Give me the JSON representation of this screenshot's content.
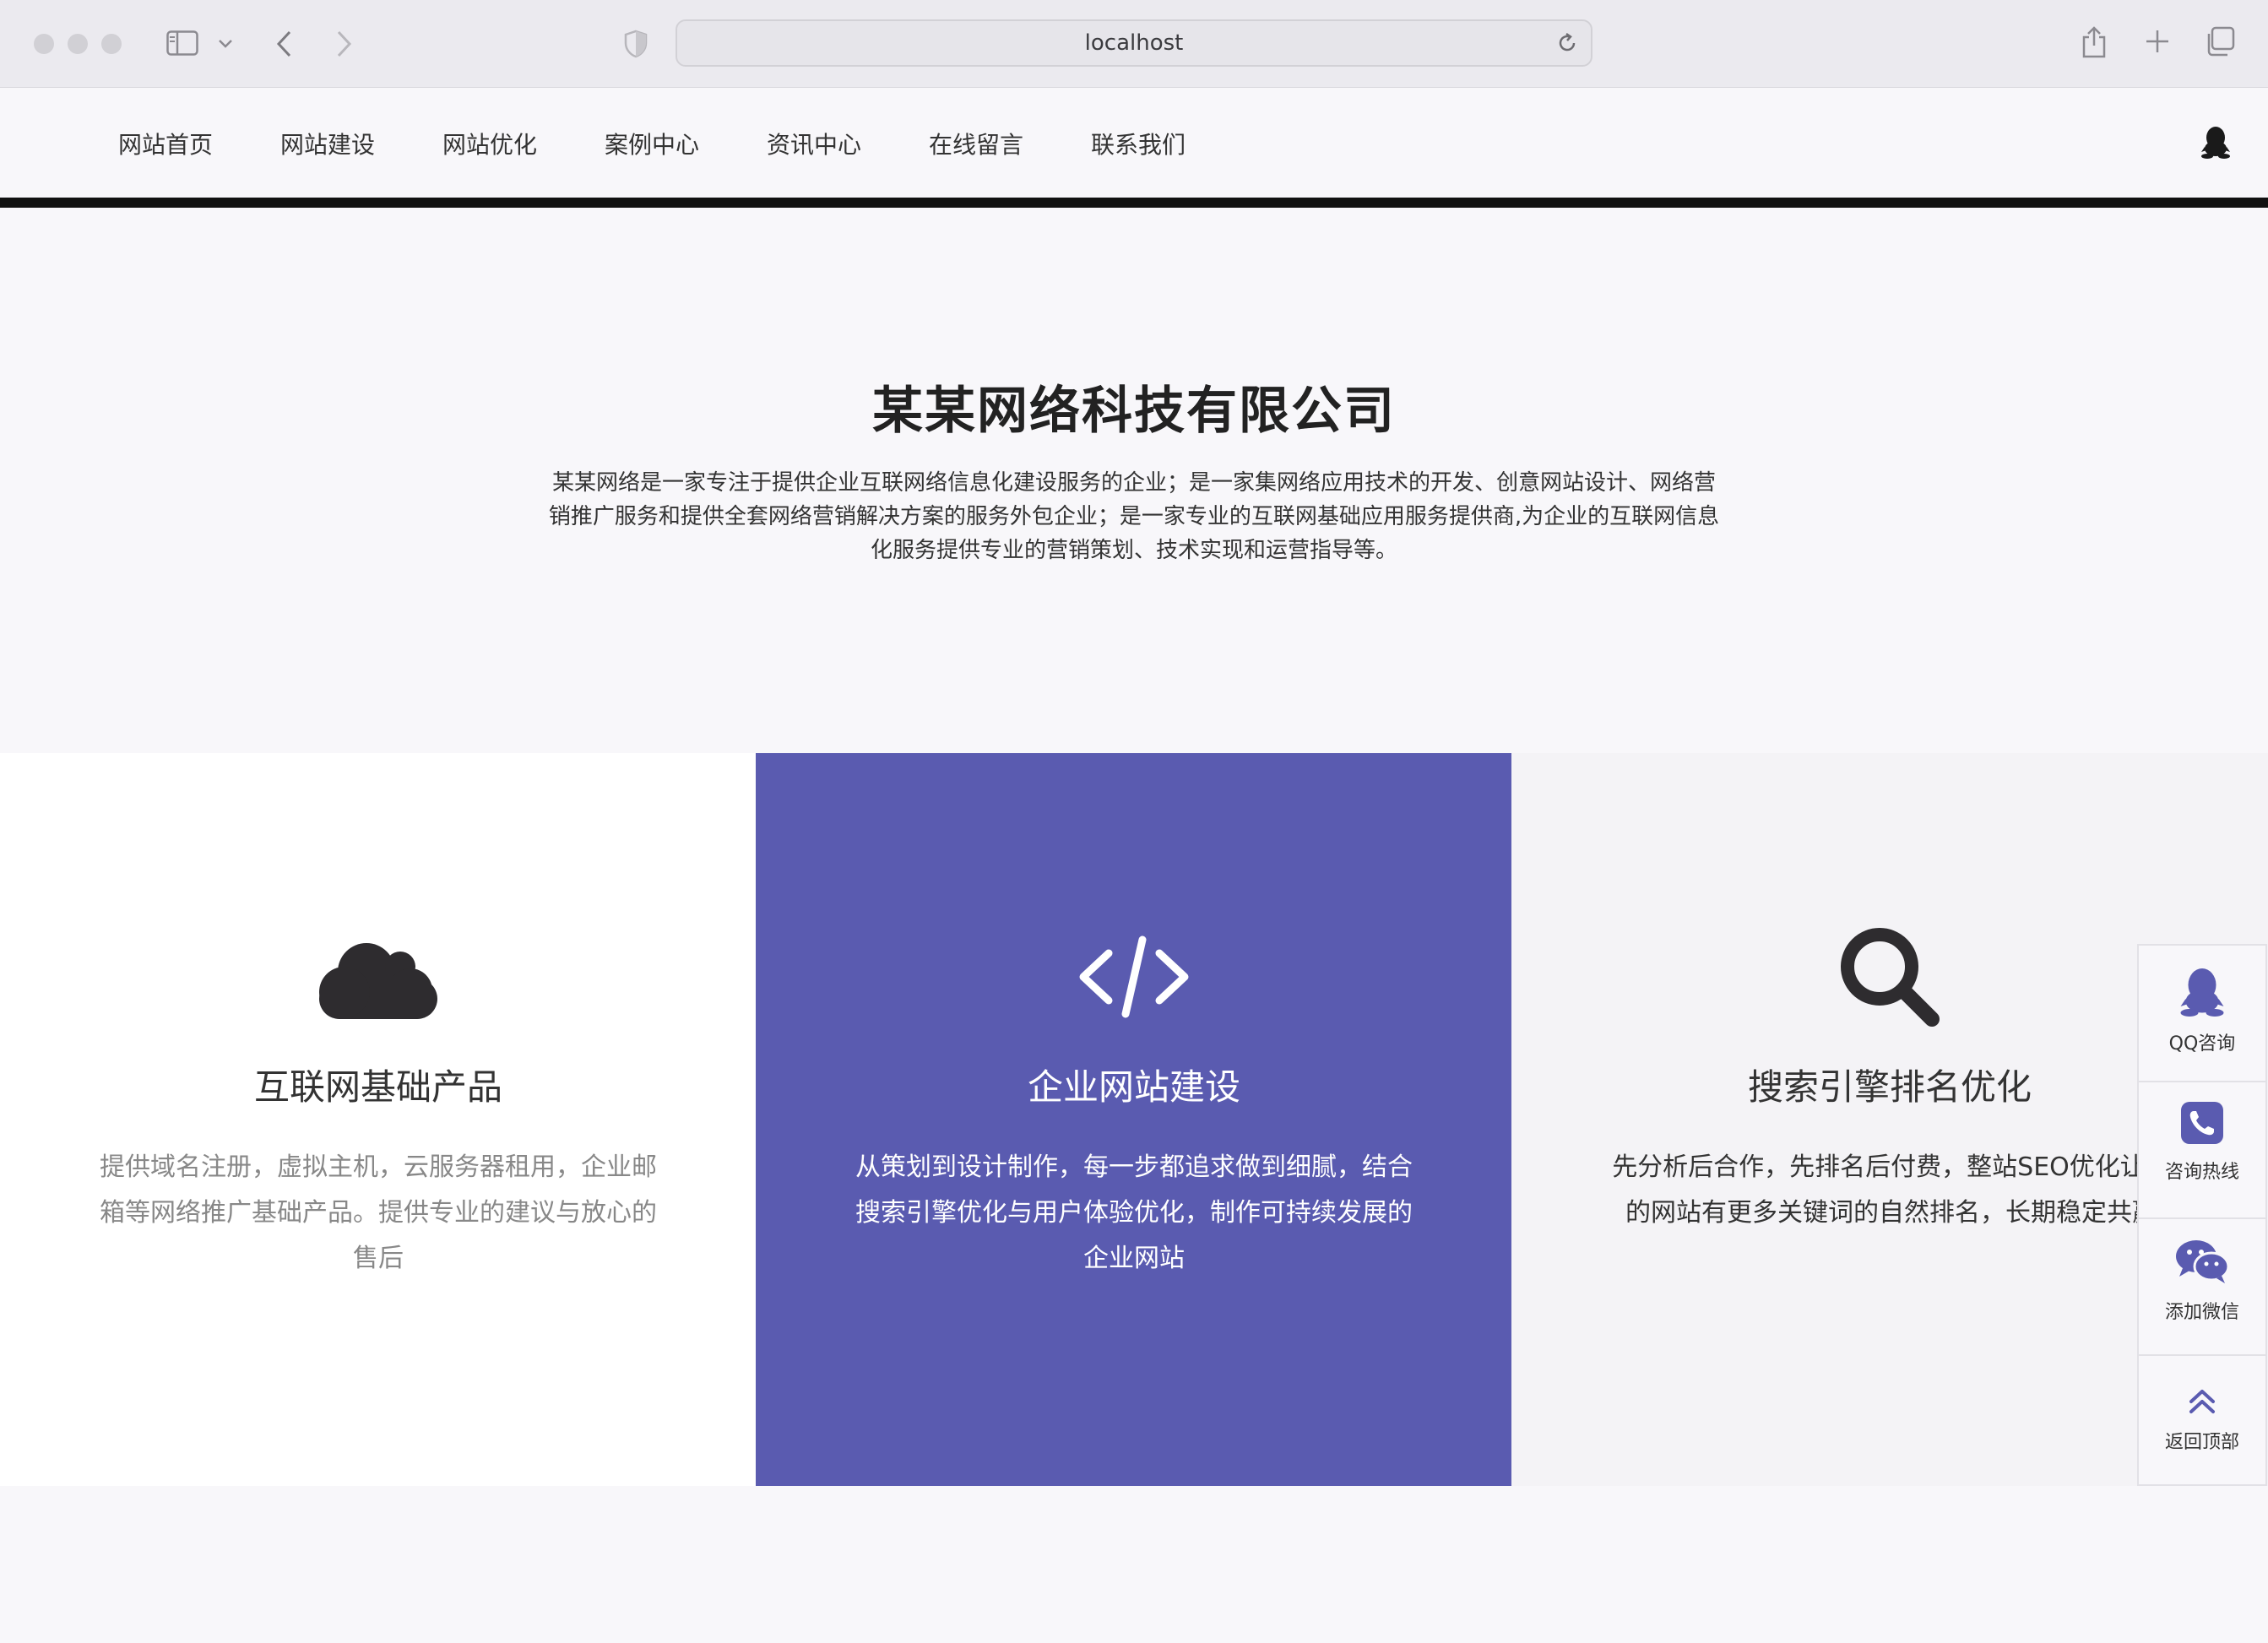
{
  "browser": {
    "url": "localhost"
  },
  "nav": {
    "items": [
      "网站首页",
      "网站建设",
      "网站优化",
      "案例中心",
      "资讯中心",
      "在线留言",
      "联系我们"
    ]
  },
  "intro": {
    "title": "某某网络科技有限公司",
    "desc_line1": "某某网络是一家专注于提供企业互联网络信息化建设服务的企业；是一家集网络应用技术的开发、创意网站设计、网络营",
    "desc_line2": "销推广服务和提供全套网络营销解决方案的服务外包企业；是一家专业的互联网基础应用服务提供商,为企业的互联网信息",
    "desc_line3": "化服务提供专业的营销策划、技术实现和运营指导等。"
  },
  "cards": [
    {
      "icon": "cloud-icon",
      "title": "互联网基础产品",
      "lines": [
        "提供域名注册，虚拟主机，云服务器租用，企业邮",
        "箱等网络推广基础产品。提供专业的建议与放心的",
        "售后"
      ]
    },
    {
      "icon": "code-icon",
      "title": "企业网站建设",
      "lines": [
        "从策划到设计制作，每一步都追求做到细腻，结合",
        "搜索引擎优化与用户体验优化，制作可持续发展的",
        "企业网站"
      ]
    },
    {
      "icon": "search-icon",
      "title": "搜索引擎排名优化",
      "lines": [
        "先分析后合作，先排名后付费，整站SEO优化让您",
        "的网站有更多关键词的自然排名，长期稳定共赢"
      ]
    }
  ],
  "float_bar": {
    "items": [
      {
        "icon": "qq-icon",
        "label": "QQ咨询"
      },
      {
        "icon": "phone-icon",
        "label": "咨询热线"
      },
      {
        "icon": "wechat-icon",
        "label": "添加微信"
      },
      {
        "icon": "double-chevron-up-icon",
        "label": "返回顶部"
      }
    ]
  },
  "colors": {
    "accent": "#5a5bb0",
    "nav_bar": "#111111",
    "page_bg": "#f8f7fa"
  }
}
